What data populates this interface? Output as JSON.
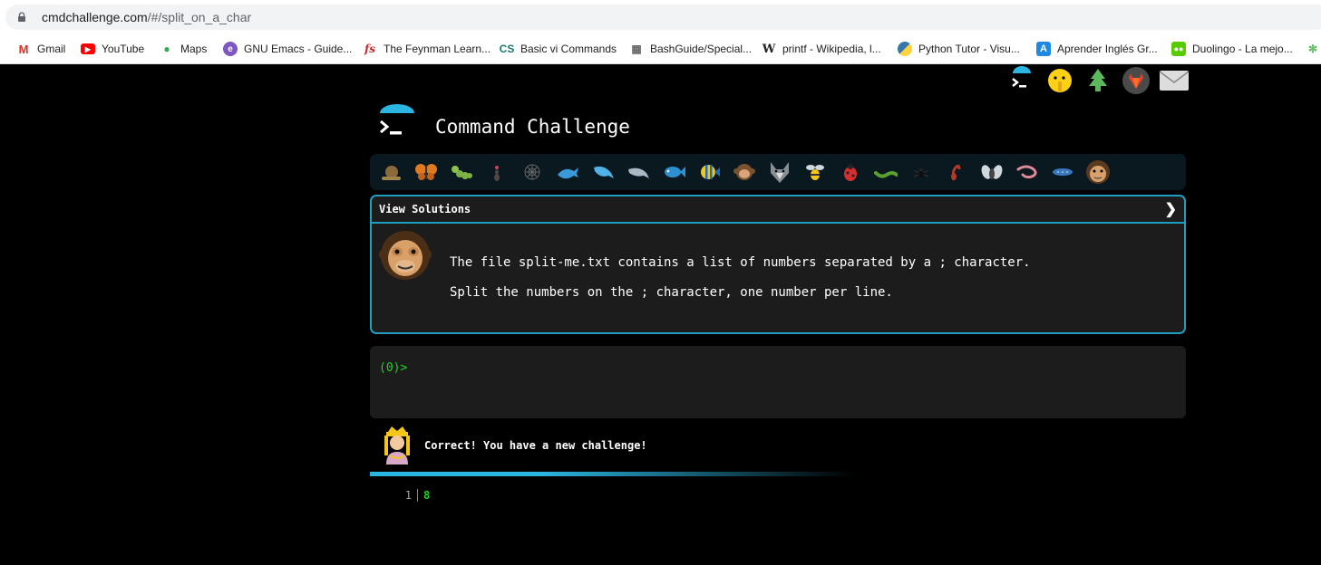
{
  "browser": {
    "url_domain": "cmdchallenge.com",
    "url_path": "/#/split_on_a_char",
    "bookmarks": [
      {
        "label": "Gmail",
        "icon": "gmail-icon"
      },
      {
        "label": "YouTube",
        "icon": "youtube-icon"
      },
      {
        "label": "Maps",
        "icon": "maps-icon"
      },
      {
        "label": "GNU Emacs - Guide...",
        "icon": "emacs-icon"
      },
      {
        "label": "The Feynman Learn...",
        "icon": "fs-icon"
      },
      {
        "label": "Basic vi Commands",
        "icon": "cs-icon"
      },
      {
        "label": "BashGuide/Special...",
        "icon": "bashguide-icon"
      },
      {
        "label": "printf - Wikipedia, l...",
        "icon": "wikipedia-icon"
      },
      {
        "label": "Python Tutor - Visu...",
        "icon": "python-icon"
      },
      {
        "label": "Aprender Inglés Gr...",
        "icon": "aprender-icon"
      },
      {
        "label": "Duolingo - La mejo...",
        "icon": "duolingo-icon"
      }
    ]
  },
  "app": {
    "title": "Command Challenge",
    "panel_title": "View Solutions",
    "description_line1": "The file split-me.txt contains a list of numbers separated by a ; character.",
    "description_line2": "Split the numbers on the ; character, one number per line.",
    "prompt": "(0)>",
    "status_message": "Correct! You have a new challenge!",
    "output": {
      "line_number": "1",
      "value": "8"
    },
    "colors": {
      "accent": "#1e9fc0",
      "prompt": "#21d321",
      "panel_bg": "#1c1c1c"
    }
  },
  "top_icons": [
    "terminal-icon",
    "shush-emoji-icon",
    "tree-icon",
    "gitlab-icon",
    "envelope-icon"
  ],
  "challenge_icons": [
    "snail-icon",
    "butterfly-icon",
    "caterpillar-icon",
    "ant-icon",
    "spider-web-icon",
    "whale-icon",
    "dolphin-icon",
    "dolphin-gray-icon",
    "fish-icon",
    "tropical-fish-icon",
    "monkey-face-icon",
    "wolf-icon",
    "bee-icon",
    "ladybug-icon",
    "worm-icon",
    "spider-icon",
    "scorpion-icon",
    "fly-icon",
    "shrimp-icon",
    "blue-worm-icon",
    "chimp-icon"
  ]
}
